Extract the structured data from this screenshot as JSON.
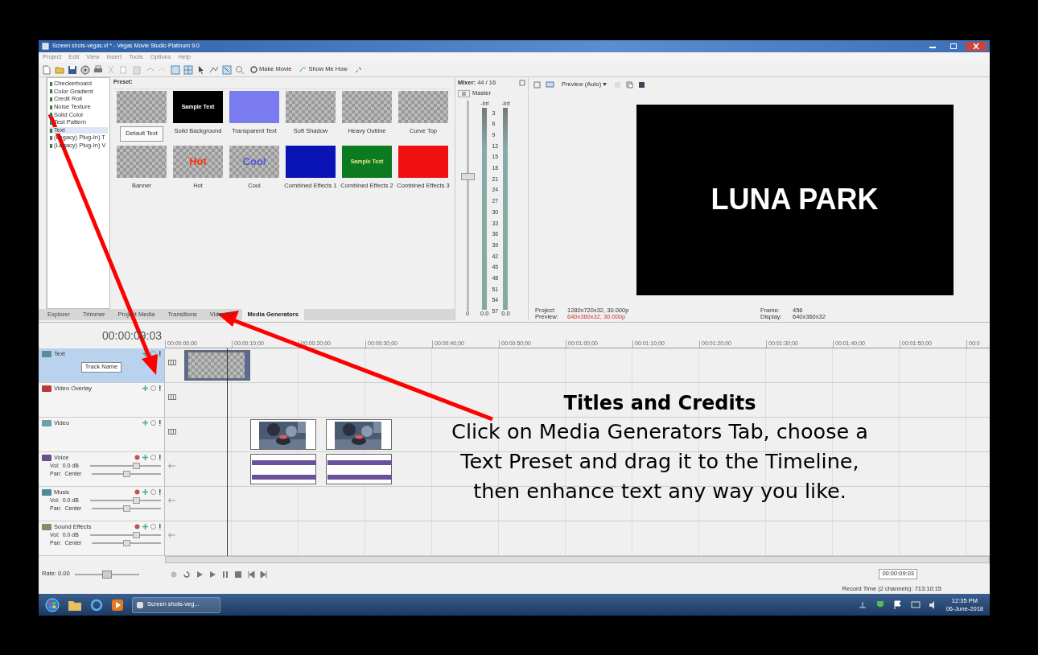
{
  "window": {
    "title": "Screen shots-vegas.vf * - Vegas Movie Studio Platinum 9.0"
  },
  "menu": [
    "Project",
    "Edit",
    "View",
    "Insert",
    "Tools",
    "Options",
    "Help"
  ],
  "toolbar": {
    "buttons": [
      "Make Movie",
      "Show Me How"
    ]
  },
  "generators": [
    {
      "label": "Checkerboard",
      "selected": false
    },
    {
      "label": "Color Gradient",
      "selected": false
    },
    {
      "label": "Credit Roll",
      "selected": false
    },
    {
      "label": "Noise Texture",
      "selected": false
    },
    {
      "label": "Solid Color",
      "selected": false
    },
    {
      "label": "Test Pattern",
      "selected": false
    },
    {
      "label": "Text",
      "selected": true
    },
    {
      "label": "(Legacy) Plug-In) T",
      "selected": false
    },
    {
      "label": "(Legacy) Plug-In) V",
      "selected": false
    }
  ],
  "presets": {
    "heading": "Preset:",
    "items": [
      {
        "label": "Default Text",
        "kind": "checker",
        "selected": true
      },
      {
        "label": "Solid Background",
        "kind": "solid",
        "color": "#000000",
        "sample": {
          "text": "Sample Text",
          "color": "#ffffff"
        },
        "selected": false
      },
      {
        "label": "Transparent Text",
        "kind": "solid",
        "color": "#7b7bf0",
        "selected": false
      },
      {
        "label": "Soft Shadow",
        "kind": "checker",
        "selected": false
      },
      {
        "label": "Heavy Outline",
        "kind": "checker",
        "selected": false
      },
      {
        "label": "Curve Top",
        "kind": "checker",
        "selected": false
      },
      {
        "label": "Banner",
        "kind": "checker",
        "selected": false
      },
      {
        "label": "Hot",
        "kind": "checker",
        "sample": {
          "text": "Hot",
          "color": "#ff3300"
        },
        "selected": false
      },
      {
        "label": "Cool",
        "kind": "checker",
        "sample": {
          "text": "Cool",
          "color": "#5555dd"
        },
        "selected": false
      },
      {
        "label": "Combined Effects 1",
        "kind": "solid",
        "color": "#0a14b4",
        "selected": false
      },
      {
        "label": "Combined Effects 2",
        "kind": "solid",
        "color": "#0c7a1e",
        "sample": {
          "text": "Sample Text",
          "color": "#e8e890"
        },
        "selected": false
      },
      {
        "label": "Combined Effects 3",
        "kind": "solid",
        "color": "#f01010",
        "selected": false
      }
    ]
  },
  "tabs": [
    {
      "label": "Explorer",
      "selected": false
    },
    {
      "label": "Trimmer",
      "selected": false
    },
    {
      "label": "Project Media",
      "selected": false
    },
    {
      "label": "Transitions",
      "selected": false
    },
    {
      "label": "Video FX",
      "selected": false
    },
    {
      "label": "Media Generators",
      "selected": true
    }
  ],
  "mixer": {
    "title": "**Mixer:** 44 / 16",
    "master": "Master",
    "fader": {
      "level": 0.62
    },
    "inf": [
      "-Inf",
      "-Inf"
    ],
    "scale": [
      "3",
      "6",
      "9",
      "12",
      "15",
      "18",
      "21",
      "24",
      "27",
      "30",
      "33",
      "36",
      "39",
      "42",
      "45",
      "48",
      "51",
      "54",
      "57"
    ],
    "readings": [
      "0",
      "0.0",
      "0.0"
    ]
  },
  "preview": {
    "mode": "Preview (Auto)",
    "frame_text": "LUNA PARK",
    "info": [
      {
        "label": "Project:",
        "value": "1280x720x32, 30.000p",
        "highlight": false
      },
      {
        "label": "Preview:",
        "value": "640x360x32, 30.000p",
        "highlight": true
      },
      {
        "label": "Frame:",
        "value": "456",
        "highlight": false
      },
      {
        "label": "Display:",
        "value": "640x360x32",
        "highlight": false
      }
    ]
  },
  "timeline": {
    "timecode": "00:00:09:03",
    "ruler": [
      "00:00:00;00",
      "00:00:10;00",
      "00:00:20;00",
      "00:00:30;00",
      "00:00:40;00",
      "00:00:50;00",
      "00:01:00;00",
      "00:01:10;00",
      "00:01:20;00",
      "00:01:30;00",
      "00:01:40;00",
      "00:01:50;00",
      "00:0"
    ],
    "tracks": [
      {
        "name": "Text",
        "kind": "video",
        "color": "#5f8a96",
        "selected": true,
        "tip": "Track Name",
        "events": [
          {
            "kind": "text"
          }
        ]
      },
      {
        "name": "Video Overlay",
        "kind": "video",
        "color": "#b83a3a",
        "selected": false
      },
      {
        "name": "Video",
        "kind": "video",
        "color": "#6aa0aa",
        "selected": false,
        "events": [
          {
            "kind": "video"
          },
          {
            "kind": "video"
          }
        ]
      },
      {
        "name": "Voice",
        "kind": "audio",
        "color": "#6a4f8a",
        "selected": false,
        "vol_label": "Vol:",
        "vol": "0.0 dB",
        "pan_label": "Pan:",
        "pan": "Center",
        "events": [
          {
            "kind": "audio"
          },
          {
            "kind": "audio"
          }
        ]
      },
      {
        "name": "Music",
        "kind": "audio",
        "color": "#4f8a9a",
        "selected": false,
        "vol_label": "Vol:",
        "vol": "0.0 dB",
        "pan_label": "Pan:",
        "pan": "Center"
      },
      {
        "name": "Sound Effects",
        "kind": "audio",
        "color": "#8a8a6a",
        "selected": false,
        "vol_label": "Vol:",
        "vol": "0.0 dB",
        "pan_label": "Pan:",
        "pan": "Center"
      }
    ],
    "rate": "Rate: 0.00",
    "rate_slider": {
      "level": 0.5
    },
    "end_timecode": "00:00:09:03"
  },
  "status": "Record Time (2 channels): 713:10:15",
  "taskbar": {
    "task": "Screen shots-veg...",
    "time": "12:35 PM",
    "date": "06-June-2018"
  },
  "annotation": {
    "title": "Titles and Credits",
    "lines": [
      "Click on Media Generators Tab, choose a",
      "Text Preset and drag it to the Timeline,",
      "then enhance text any way you like."
    ]
  }
}
